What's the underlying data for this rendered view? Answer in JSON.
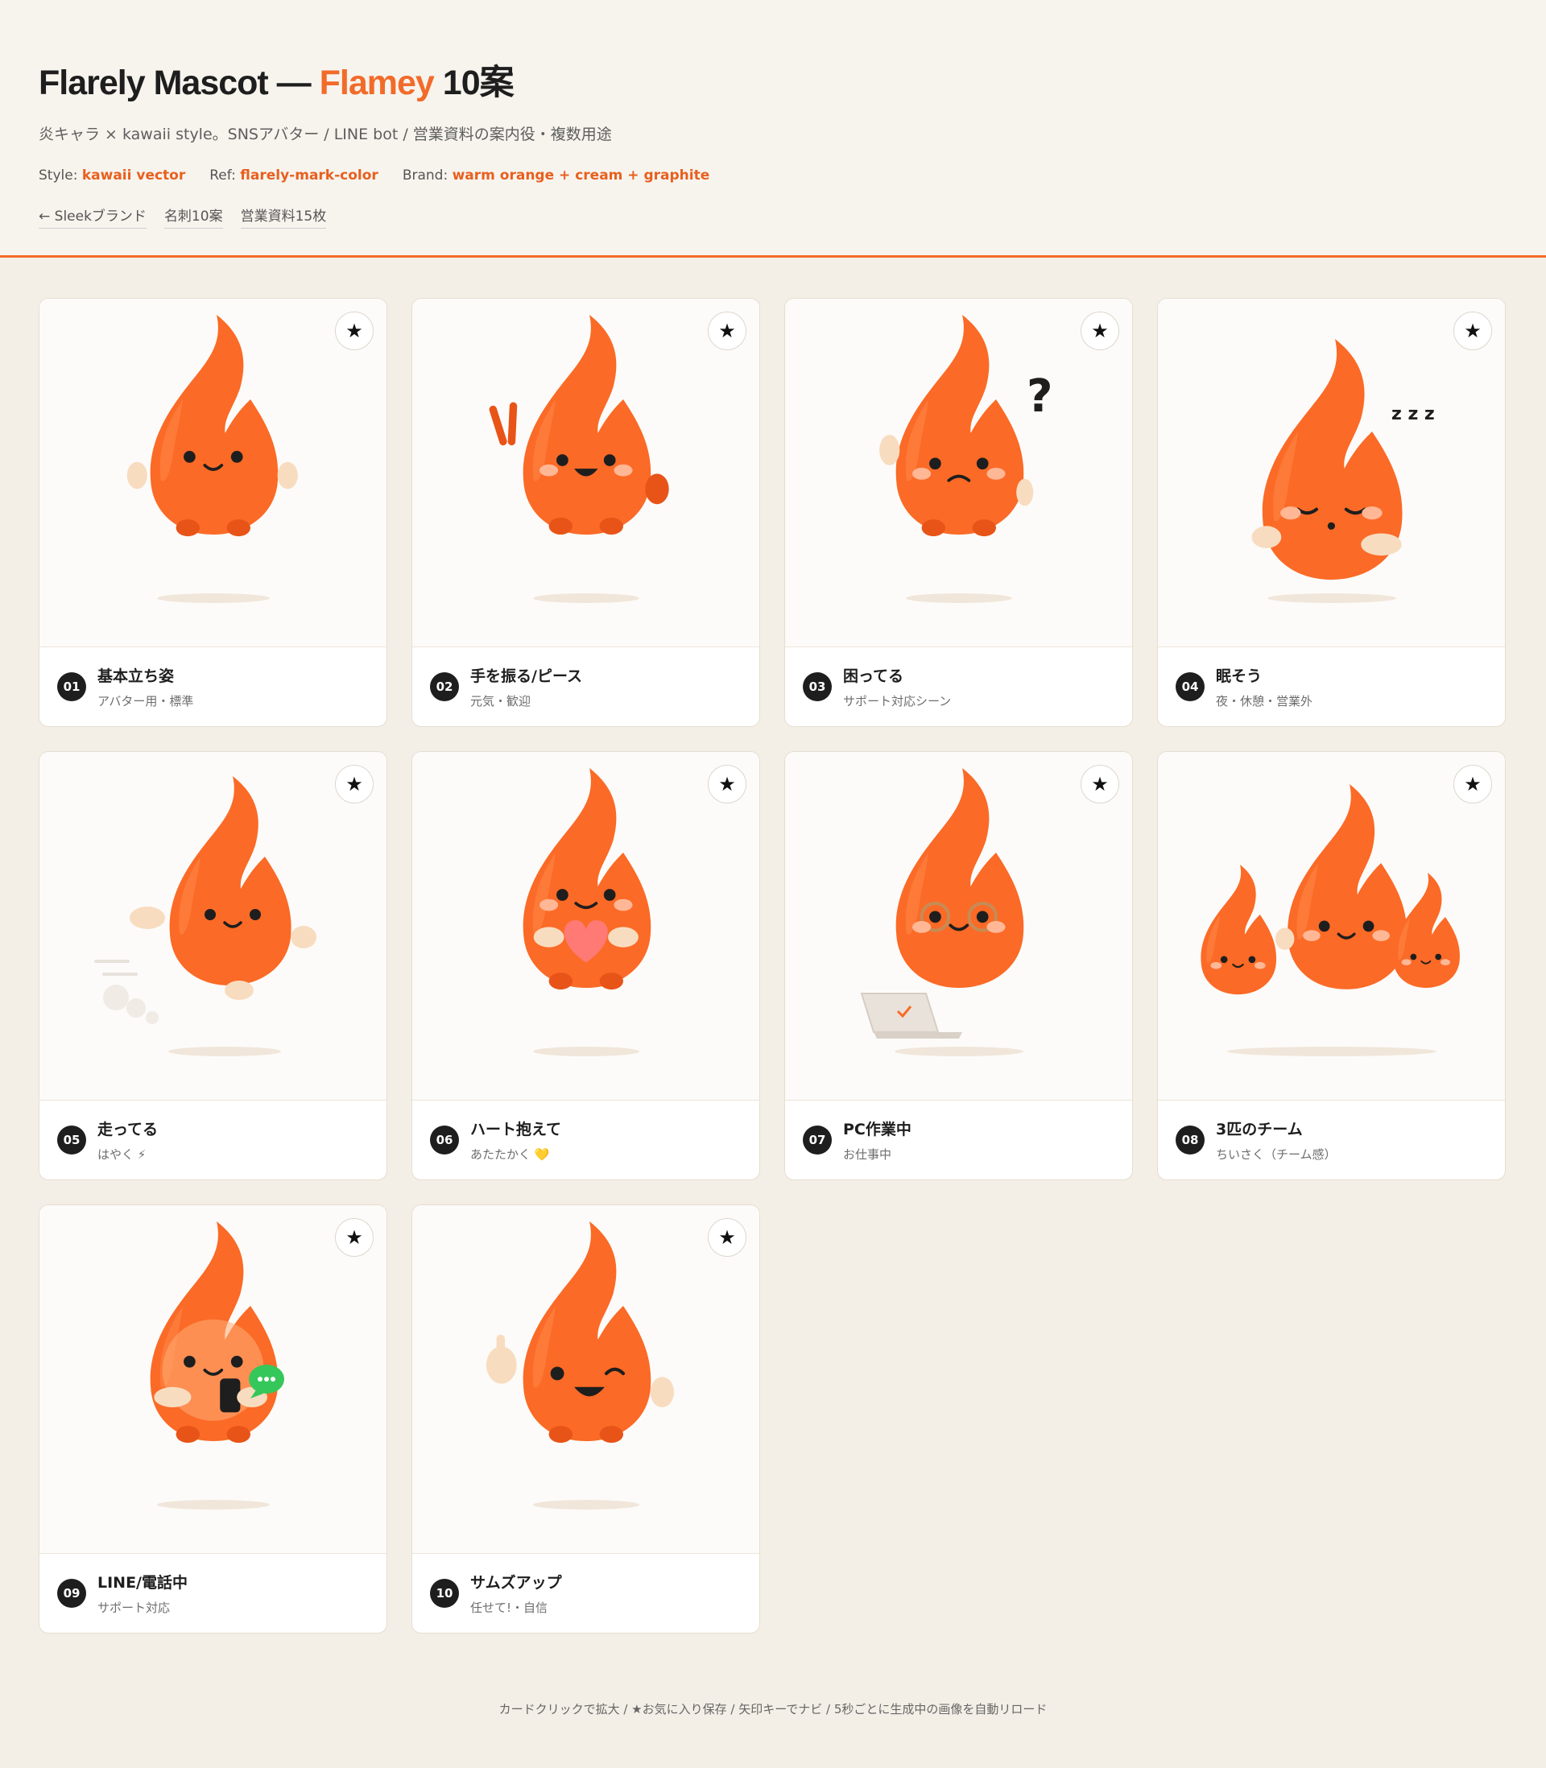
{
  "header": {
    "title_pre": "Flarely Mascot — ",
    "title_accent": "Flamey",
    "title_post": " 10案",
    "subtitle": "炎キャラ × kawaii style。SNSアバター / LINE bot / 営業資料の案内役・複数用途",
    "meta": [
      {
        "label": "Style:",
        "value": "kawaii vector"
      },
      {
        "label": "Ref:",
        "value": "flarely-mark-color"
      },
      {
        "label": "Brand:",
        "value": "warm orange + cream + graphite"
      }
    ],
    "links": [
      "← Sleekブランド",
      "名刺10案",
      "営業資料15枚"
    ]
  },
  "colors": {
    "accent": "#f26b2a",
    "flame": "#fb6a26",
    "flame_dark": "#e85418",
    "cream": "#f8dcc0",
    "blush": "#ffb796",
    "graphite": "#1e1e1e"
  },
  "cards": [
    {
      "num": "01",
      "name": "基本立ち姿",
      "desc": "アバター用・標準",
      "pose": "stand",
      "star": "★"
    },
    {
      "num": "02",
      "name": "手を振る/ピース",
      "desc": "元気・歓迎",
      "pose": "peace",
      "star": "★"
    },
    {
      "num": "03",
      "name": "困ってる",
      "desc": "サポート対応シーン",
      "pose": "confused",
      "star": "★"
    },
    {
      "num": "04",
      "name": "眠そう",
      "desc": "夜・休憩・営業外",
      "pose": "sleepy",
      "star": "★"
    },
    {
      "num": "05",
      "name": "走ってる",
      "desc": "はやく ⚡",
      "pose": "run",
      "star": "★"
    },
    {
      "num": "06",
      "name": "ハート抱えて",
      "desc": "あたたかく 💛",
      "pose": "heart",
      "star": "★"
    },
    {
      "num": "07",
      "name": "PC作業中",
      "desc": "お仕事中",
      "pose": "laptop",
      "star": "★"
    },
    {
      "num": "08",
      "name": "3匹のチーム",
      "desc": "ちいさく（チーム感）",
      "pose": "team",
      "star": "★"
    },
    {
      "num": "09",
      "name": "LINE/電話中",
      "desc": "サポート対応",
      "pose": "phone",
      "star": "★"
    },
    {
      "num": "10",
      "name": "サムズアップ",
      "desc": "任せて!・自信",
      "pose": "thumbs",
      "star": "★"
    }
  ],
  "footer": "カードクリックで拡大 / ★お気に入り保存 / 矢印キーでナビ / 5秒ごとに生成中の画像を自動リロード"
}
